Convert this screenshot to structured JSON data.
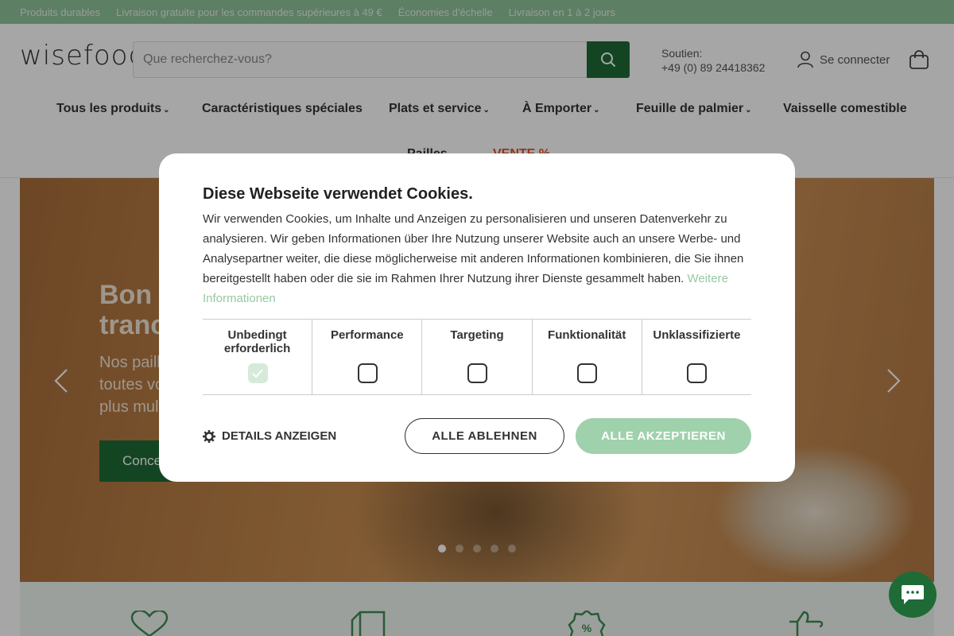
{
  "topbar": {
    "items": [
      "Produits durables",
      "Livraison gratuite pour les commandes supérieures à 49 €",
      "Économies d'échelle",
      "Livraison en 1 à 2 jours"
    ]
  },
  "header": {
    "logo": "wisefood",
    "search_placeholder": "Que recherchez-vous?",
    "support_label": "Soutien:",
    "support_phone": "+49 (0) 89 24418362",
    "login_label": "Se connecter"
  },
  "nav": {
    "items": [
      {
        "label": "Tous les produits",
        "caret": "⌄"
      },
      {
        "label": "Caractéristiques spéciales"
      },
      {
        "label": "Plats et service",
        "caret": "⌄"
      },
      {
        "label": "À Emporter",
        "caret": "⌄"
      },
      {
        "label": "Feuille de palmier",
        "caret": "⌄"
      },
      {
        "label": "Vaisselle comestible"
      },
      {
        "label": "Pailles"
      },
      {
        "label": "VENTE %"
      }
    ]
  },
  "hero": {
    "title_line1": "Bon",
    "title_line2": "tranc",
    "text_line1": "Nos paill",
    "text_line2": "toutes vo",
    "text_line3": "plus mult",
    "button_label": "Conce",
    "slide_count": 5,
    "active_slide": 1
  },
  "cookie": {
    "title": "Diese Webseite verwendet Cookies.",
    "body": "Wir verwenden Cookies, um Inhalte und Anzeigen zu personalisieren und unseren Datenverkehr zu analysieren. Wir geben Informationen über Ihre Nutzung unserer Website auch an unsere Werbe- und Analysepartner weiter, die diese möglicherweise mit anderen Informationen kombinieren, die Sie ihnen bereitgestellt haben oder die sie im Rahmen Ihrer Nutzung ihrer Dienste gesammelt haben.",
    "more_link": "Weitere Informationen",
    "categories": [
      {
        "label": "Unbedingt erforderlich",
        "checked": true
      },
      {
        "label": "Performance",
        "checked": false
      },
      {
        "label": "Targeting",
        "checked": false
      },
      {
        "label": "Funktionalität",
        "checked": false
      },
      {
        "label": "Unklassifizierte",
        "checked": false
      }
    ],
    "details_label": "DETAILS ANZEIGEN",
    "reject_label": "ALLE ABLEHNEN",
    "accept_label": "ALLE AKZEPTIEREN"
  },
  "colors": {
    "topbar": "#8fc49a",
    "brand_green": "#1e6b36",
    "sale": "#e0522f",
    "accept_button": "#9fd1ac",
    "link": "#96c9a2"
  },
  "icons": [
    "search-icon",
    "user-icon",
    "cart-icon",
    "chevron-left-icon",
    "chevron-right-icon",
    "gear-icon",
    "heart-icon",
    "box-icon",
    "discount-badge-icon",
    "thumbs-up-icon",
    "chat-icon"
  ]
}
